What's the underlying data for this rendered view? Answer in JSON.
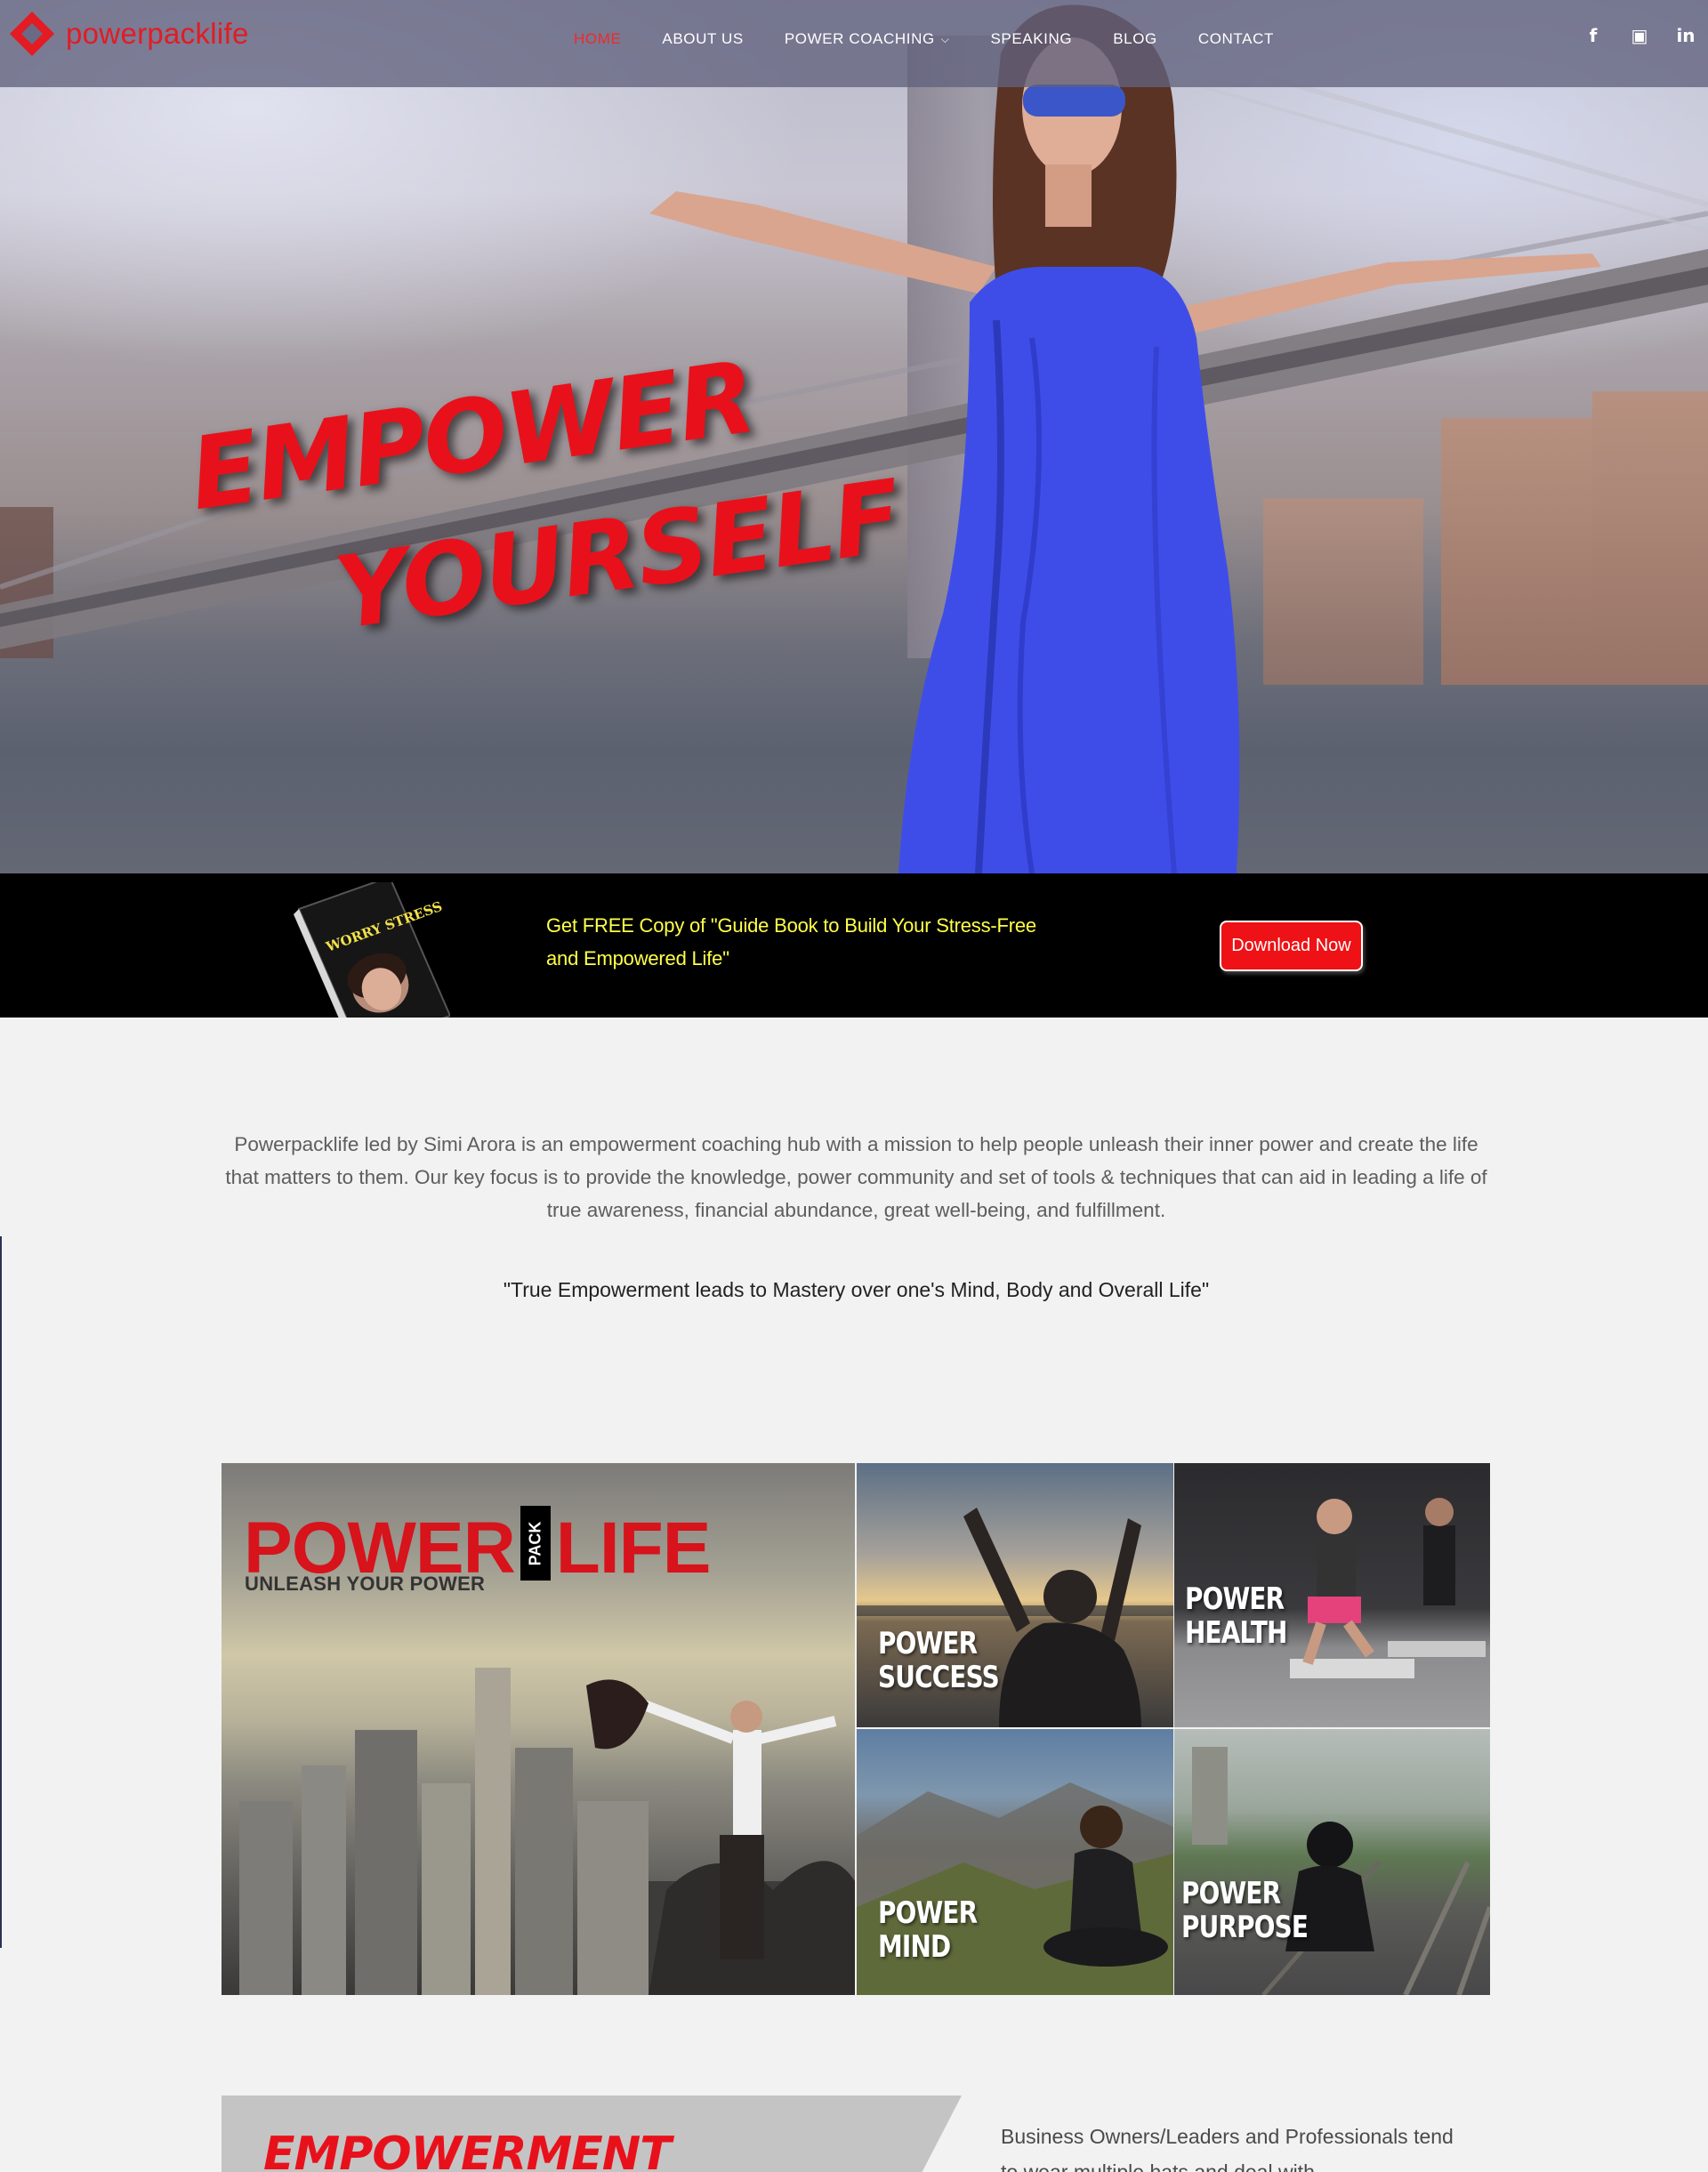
{
  "brand": {
    "name": "powerpacklife",
    "accent": "#e31b23"
  },
  "nav": {
    "items": [
      {
        "label": "HOME",
        "active": true
      },
      {
        "label": "ABOUT US",
        "active": false
      },
      {
        "label": "POWER COACHING",
        "active": false,
        "dropdown": true
      },
      {
        "label": "SPEAKING",
        "active": false
      },
      {
        "label": "BLOG",
        "active": false
      },
      {
        "label": "CONTACT",
        "active": false
      }
    ]
  },
  "social": {
    "icons": [
      "facebook-icon",
      "instagram-icon",
      "linkedin-icon"
    ],
    "glyphs": [
      "f",
      "▣",
      "in"
    ]
  },
  "hero": {
    "line1": "EMPOWER",
    "line2": "YOURSELF"
  },
  "promo": {
    "text": "Get FREE Copy of \"Guide Book to Build Your Stress-Free and Empowered Life\"",
    "button": "Download Now",
    "book_cover_text": "WORRY STRESS"
  },
  "intro": {
    "paragraph": "Powerpacklife led by Simi Arora is an empowerment coaching hub with a mission to help people unleash their inner power and create the life that matters to them. Our key focus is to provide the knowledge, power community and set of tools & techniques that can aid in leading a life of true awareness, financial abundance, great well-being, and fulfillment.",
    "quote": "\"True Empowerment leads to Mastery over one's Mind, Body and Overall Life\""
  },
  "grid": {
    "main": {
      "left_word": "POWER",
      "pack_word": "PACK",
      "right_word": "LIFE",
      "tagline": "UNLEASH YOUR POWER"
    },
    "tiles": [
      {
        "line1": "POWER",
        "line2": "SUCCESS"
      },
      {
        "line1": "POWER",
        "line2": "HEALTH"
      },
      {
        "line1": "POWER",
        "line2": "MIND"
      },
      {
        "line1": "POWER",
        "line2": "PURPOSE"
      }
    ]
  },
  "empowerment": {
    "heading": "EMPOWERMENT",
    "side_text": "Business Owners/Leaders and Professionals tend to wear multiple hats and deal with"
  }
}
